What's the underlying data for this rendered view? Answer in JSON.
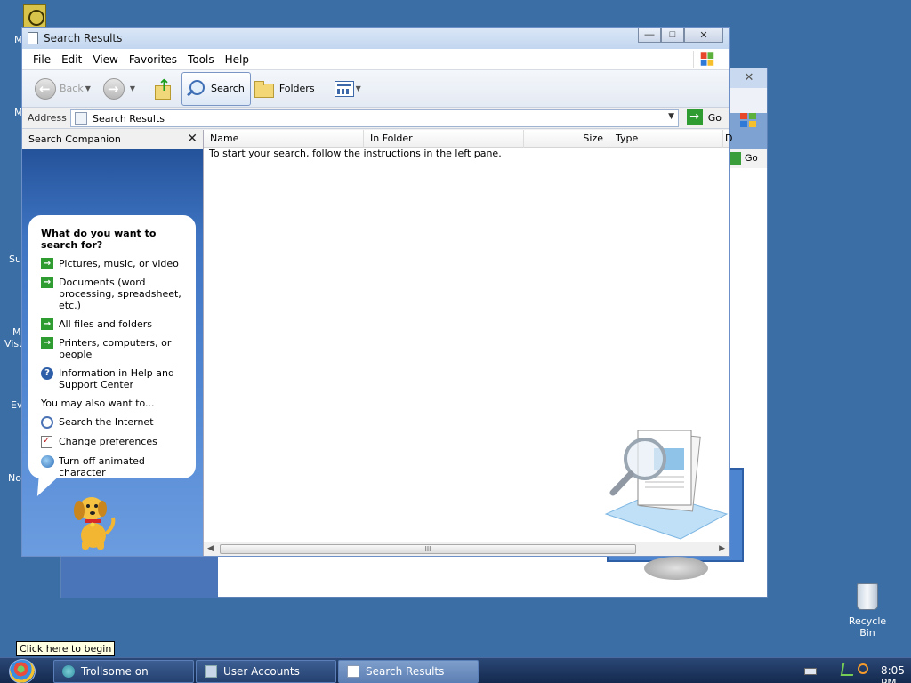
{
  "desktop": {
    "left_fragments": [
      "M",
      "M",
      "Su",
      "M",
      "Visu",
      "Ev",
      "No"
    ],
    "recycle_bin_label": "Recycle Bin"
  },
  "background_window": {
    "go_label": "Go"
  },
  "window": {
    "title": "Search Results",
    "controls": {
      "minimize": "—",
      "maximize": "□",
      "close": "✕"
    },
    "menu": [
      "File",
      "Edit",
      "View",
      "Favorites",
      "Tools",
      "Help"
    ],
    "toolbar": {
      "back_label": "Back",
      "search_label": "Search",
      "folders_label": "Folders"
    },
    "address": {
      "label": "Address",
      "value": "Search Results",
      "go_label": "Go"
    },
    "search_companion": {
      "header": "Search Companion",
      "question": "What do you want to search for?",
      "options": [
        "Pictures, music, or video",
        "Documents (word processing, spreadsheet, etc.)",
        "All files and folders",
        "Printers, computers, or people",
        "Information in Help and Support Center"
      ],
      "also_label": "You may also want to...",
      "also_options": [
        "Search the Internet",
        "Change preferences",
        "Turn off animated character"
      ]
    },
    "results": {
      "columns": [
        "Name",
        "In Folder",
        "Size",
        "Type",
        "D"
      ],
      "message": "To start your search, follow the instructions in the left pane.",
      "scroll_grip": "III"
    }
  },
  "tooltip": "Click here to begin",
  "taskbar": {
    "buttons": [
      "Trollsome on Scratc...",
      "User Accounts",
      "Search Results"
    ],
    "clock": "8:05 PM"
  },
  "colors": {
    "desktop": "#3a6ea5",
    "go_green": "#2f9c31",
    "companion_blue": "#3e74c2"
  }
}
